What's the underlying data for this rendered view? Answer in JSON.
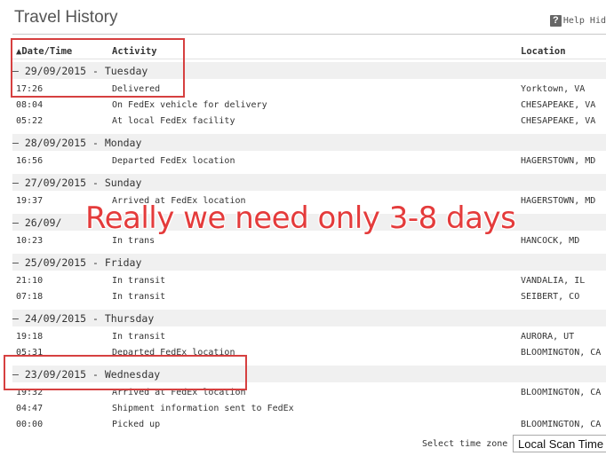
{
  "title": "Travel History",
  "help_label": "Help Hid",
  "columns": {
    "date_time": "▲Date/Time",
    "activity": "Activity",
    "location": "Location"
  },
  "days": [
    {
      "label": "—  29/09/2015 - Tuesday",
      "events": [
        {
          "time": "17:26",
          "activity": "Delivered",
          "location": "Yorktown, VA"
        },
        {
          "time": "08:04",
          "activity": "On FedEx vehicle for delivery",
          "location": "CHESAPEAKE, VA"
        },
        {
          "time": "05:22",
          "activity": "At local FedEx facility",
          "location": "CHESAPEAKE, VA"
        }
      ]
    },
    {
      "label": "—  28/09/2015 - Monday",
      "events": [
        {
          "time": "16:56",
          "activity": "Departed FedEx location",
          "location": "HAGERSTOWN, MD"
        }
      ]
    },
    {
      "label": "—  27/09/2015 - Sunday",
      "events": [
        {
          "time": "19:37",
          "activity": "Arrived at FedEx location",
          "location": "HAGERSTOWN, MD"
        }
      ]
    },
    {
      "label": "—  26/09/",
      "events": [
        {
          "time": "10:23",
          "activity": "In trans",
          "location": "HANCOCK, MD"
        }
      ]
    },
    {
      "label": "—  25/09/2015 - Friday",
      "events": [
        {
          "time": "21:10",
          "activity": "In transit",
          "location": "VANDALIA, IL"
        },
        {
          "time": "07:18",
          "activity": "In transit",
          "location": "SEIBERT, CO"
        }
      ]
    },
    {
      "label": "—  24/09/2015 - Thursday",
      "events": [
        {
          "time": "19:18",
          "activity": "In transit",
          "location": "AURORA, UT"
        },
        {
          "time": "05:31",
          "activity": "Departed FedEx location",
          "location": "BLOOMINGTON, CA"
        }
      ]
    },
    {
      "label": "—  23/09/2015 - Wednesday",
      "events": [
        {
          "time": "19:32",
          "activity": "Arrived at FedEx location",
          "location": "BLOOMINGTON, CA"
        },
        {
          "time": "04:47",
          "activity": "Shipment information sent to FedEx",
          "location": ""
        },
        {
          "time": "00:00",
          "activity": "Picked up",
          "location": "BLOOMINGTON, CA"
        }
      ]
    }
  ],
  "overlay_text": "Really we need only 3-8 days",
  "timezone": {
    "label": "Select time zone",
    "selected": "Local Scan Time"
  },
  "colors": {
    "annotation_red": "#d64040",
    "overlay_text": "#e43b3b"
  }
}
